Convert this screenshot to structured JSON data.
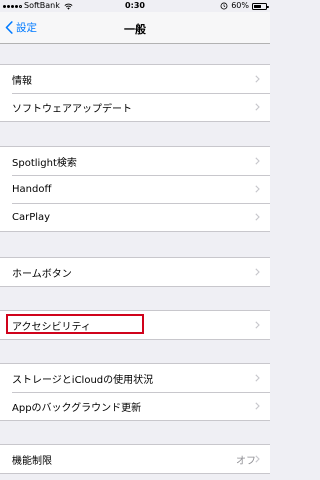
{
  "status_bar": {
    "carrier": "SoftBank",
    "time": "0:30",
    "battery_text": "60%",
    "battery_level": 0.6
  },
  "nav": {
    "back_label": "設定",
    "title": "一般"
  },
  "groups": [
    {
      "items": [
        {
          "label": "情報"
        },
        {
          "label": "ソフトウェアアップデート"
        }
      ]
    },
    {
      "items": [
        {
          "label": "Spotlight検索"
        },
        {
          "label": "Handoff"
        },
        {
          "label": "CarPlay"
        }
      ]
    },
    {
      "items": [
        {
          "label": "ホームボタン"
        }
      ]
    },
    {
      "items": [
        {
          "label": "アクセシビリティ"
        }
      ]
    },
    {
      "items": [
        {
          "label": "ストレージとiCloudの使用状況"
        },
        {
          "label": "Appのバックグラウンド更新"
        }
      ]
    },
    {
      "items": [
        {
          "label": "機能制限",
          "value": "オフ"
        }
      ]
    }
  ],
  "colors": {
    "accent": "#007aff",
    "highlight": "#d0021b"
  }
}
